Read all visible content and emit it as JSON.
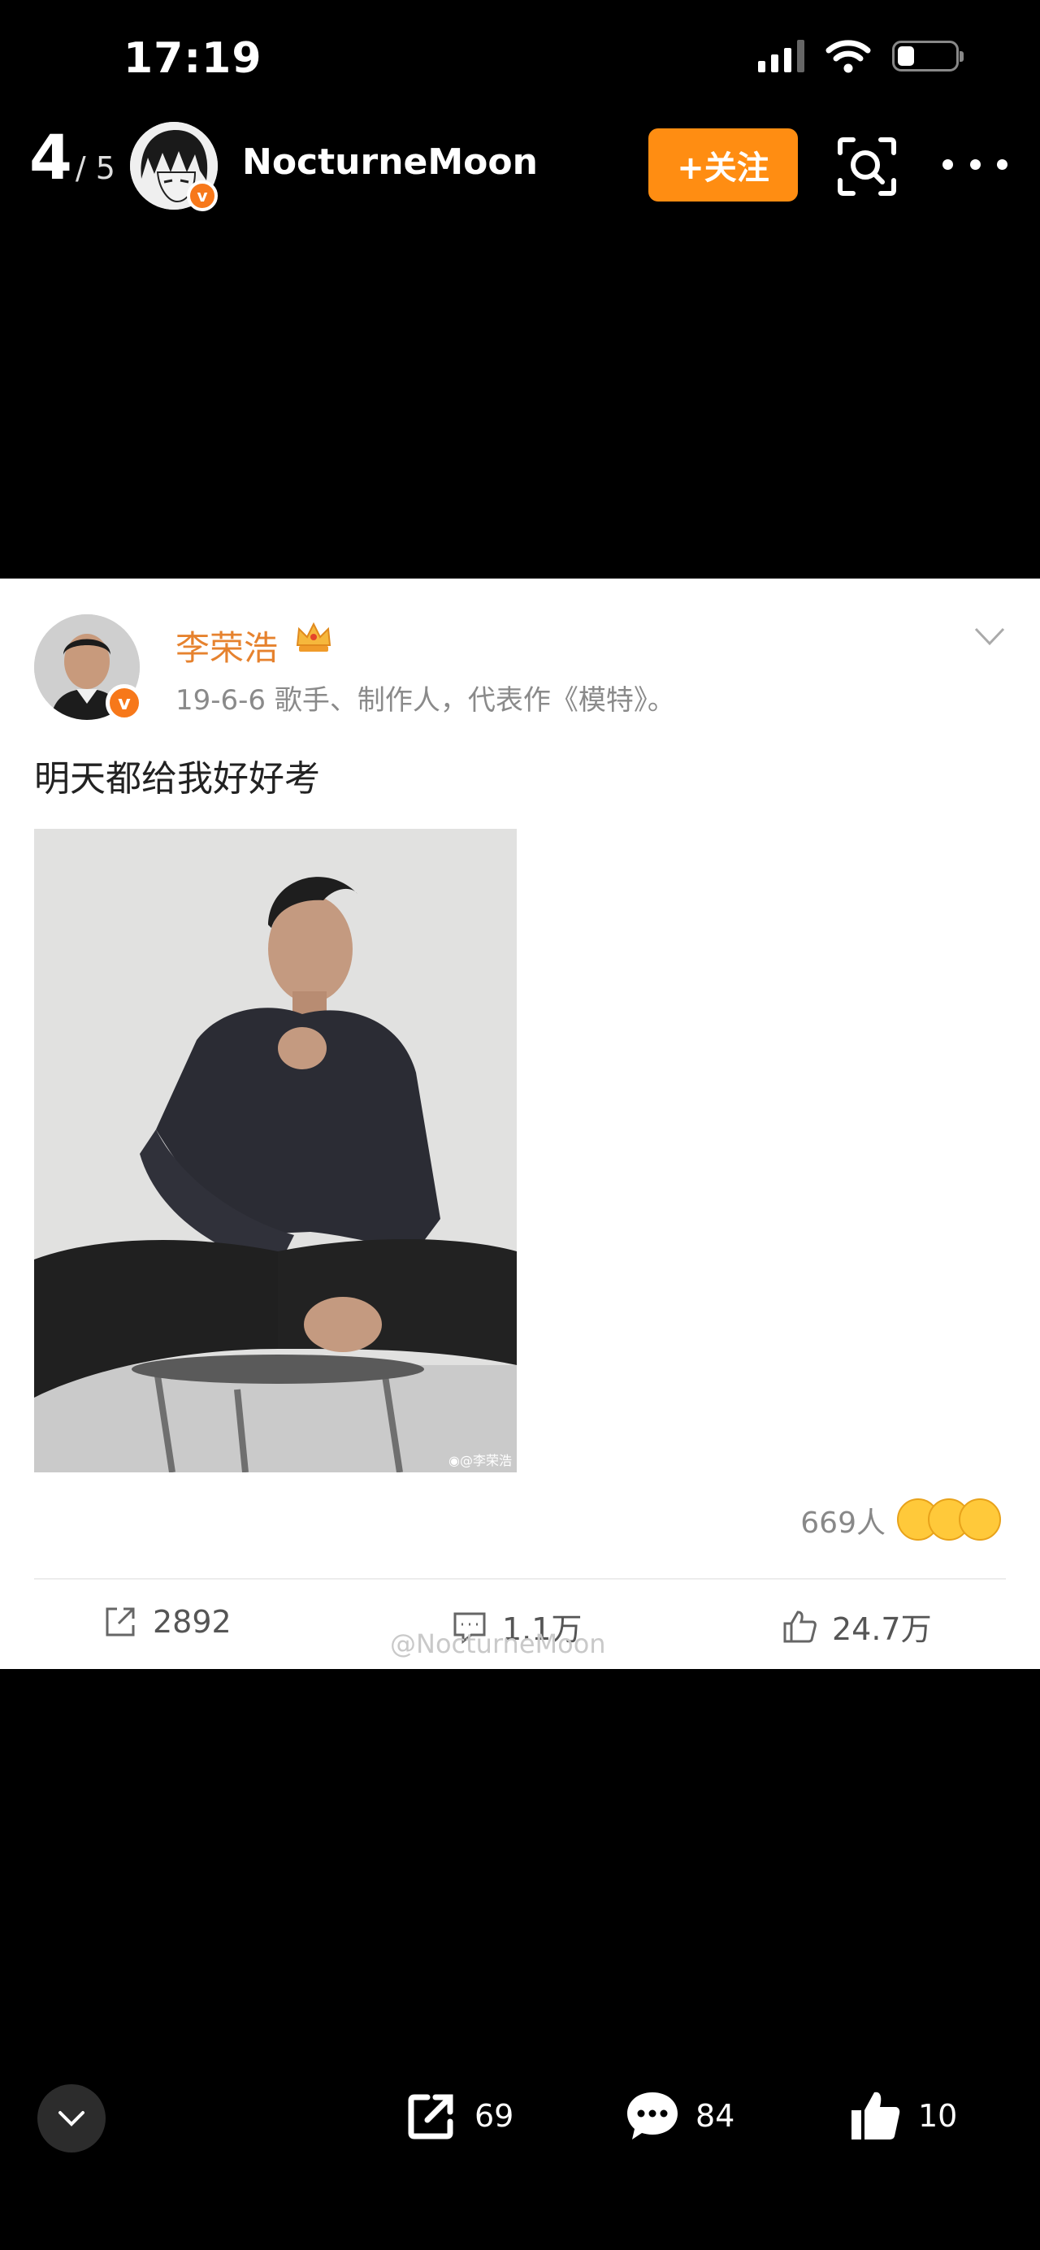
{
  "status_bar": {
    "time": "17:19"
  },
  "header": {
    "page_current": "4",
    "page_total": "/ 5",
    "username": "NocturneMoon",
    "follow_label": "+关注",
    "verified_mark": "v"
  },
  "post": {
    "author": "李荣浩",
    "meta": "19-6-6  歌手、制作人，代表作《模特》。",
    "text": "明天都给我好好考",
    "image_watermark": "◉@李荣浩",
    "reactions_count": "669人",
    "share_count": "2892",
    "comment_count": "1.1万",
    "like_count": "24.7万",
    "watermark": "@NocturneMoon",
    "verified_mark": "v"
  },
  "bottom_bar": {
    "share_count": "69",
    "comment_count": "84",
    "like_count": "10"
  },
  "colors": {
    "follow_button": "#ff8d12",
    "verified_badge": "#f7781a",
    "author_name": "#e6822e"
  },
  "icons": [
    "signal-icon",
    "wifi-icon",
    "battery-icon",
    "scan-icon",
    "more-icon",
    "crown-icon",
    "chevron-down-icon",
    "share-icon",
    "comment-icon",
    "like-icon",
    "collapse-icon"
  ]
}
